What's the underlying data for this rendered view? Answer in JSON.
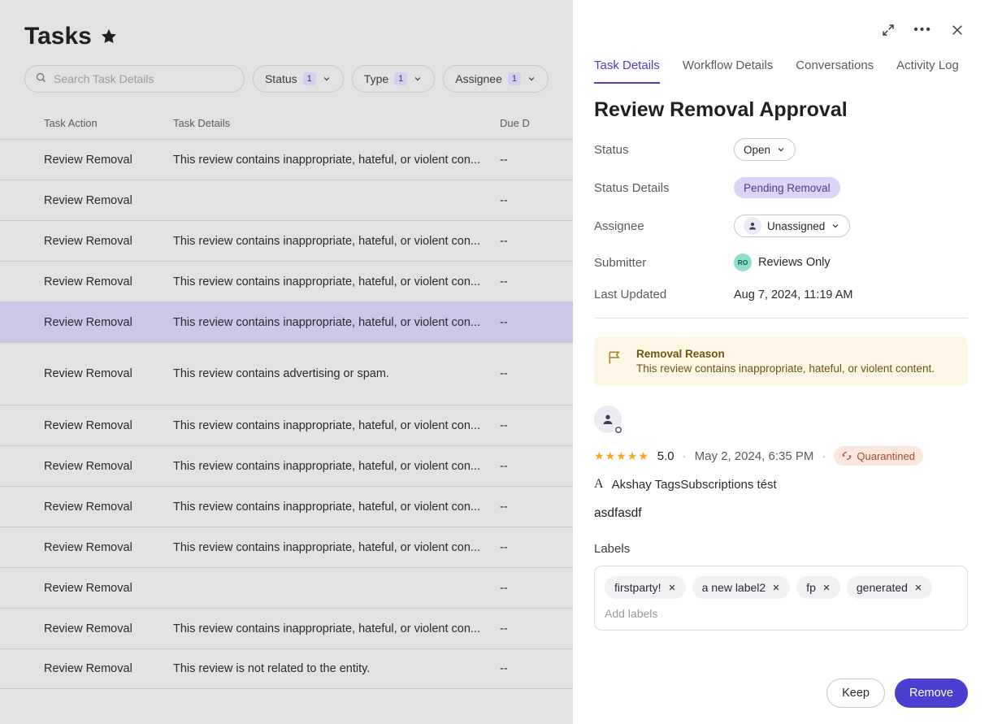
{
  "header": {
    "title": "Tasks"
  },
  "search": {
    "placeholder": "Search Task Details"
  },
  "filters": [
    {
      "label": "Status",
      "count": "1"
    },
    {
      "label": "Type",
      "count": "1"
    },
    {
      "label": "Assignee",
      "count": "1"
    }
  ],
  "columns": {
    "action": "Task Action",
    "details": "Task Details",
    "due": "Due D"
  },
  "rows": [
    {
      "action": "Review Removal",
      "details": "This review contains inappropriate, hateful, or violent con...",
      "due": "--",
      "selected": false,
      "tall": false
    },
    {
      "action": "Review Removal",
      "details": "",
      "due": "--",
      "selected": false,
      "tall": false
    },
    {
      "action": "Review Removal",
      "details": "This review contains inappropriate, hateful, or violent con...",
      "due": "--",
      "selected": false,
      "tall": false
    },
    {
      "action": "Review Removal",
      "details": "This review contains inappropriate, hateful, or violent con...",
      "due": "--",
      "selected": false,
      "tall": false
    },
    {
      "action": "Review Removal",
      "details": "This review contains inappropriate, hateful, or violent con...",
      "due": "--",
      "selected": true,
      "tall": false
    },
    {
      "action": "Review Removal",
      "details": "This review contains advertising or spam.",
      "due": "--",
      "selected": false,
      "tall": true
    },
    {
      "action": "Review Removal",
      "details": "This review contains inappropriate, hateful, or violent con...",
      "due": "--",
      "selected": false,
      "tall": false
    },
    {
      "action": "Review Removal",
      "details": "This review contains inappropriate, hateful, or violent con...",
      "due": "--",
      "selected": false,
      "tall": false
    },
    {
      "action": "Review Removal",
      "details": "This review contains inappropriate, hateful, or violent con...",
      "due": "--",
      "selected": false,
      "tall": false
    },
    {
      "action": "Review Removal",
      "details": "This review contains inappropriate, hateful, or violent con...",
      "due": "--",
      "selected": false,
      "tall": false
    },
    {
      "action": "Review Removal",
      "details": "",
      "due": "--",
      "selected": false,
      "tall": false
    },
    {
      "action": "Review Removal",
      "details": "This review contains inappropriate, hateful, or violent con...",
      "due": "--",
      "selected": false,
      "tall": false
    },
    {
      "action": "Review Removal",
      "details": "This review is not related to the entity.",
      "due": "--",
      "selected": false,
      "tall": false
    }
  ],
  "panel": {
    "tabs": [
      "Task Details",
      "Workflow Details",
      "Conversations",
      "Activity Log"
    ],
    "active_tab": 0,
    "title": "Review Removal Approval",
    "meta": {
      "status_label": "Status",
      "status_value": "Open",
      "status_details_label": "Status Details",
      "status_details_value": "Pending Removal",
      "assignee_label": "Assignee",
      "assignee_value": "Unassigned",
      "submitter_label": "Submitter",
      "submitter_initials": "RO",
      "submitter_value": "Reviews Only",
      "updated_label": "Last Updated",
      "updated_value": "Aug 7, 2024, 11:19 AM"
    },
    "notice": {
      "title": "Removal Reason",
      "text": "This review contains inappropriate, hateful, or violent content."
    },
    "review": {
      "stars": "★★★★★",
      "rating": "5.0",
      "date": "May 2, 2024, 6:35 PM",
      "badge": "Quarantined",
      "merchant_icon": "A",
      "merchant": "Akshay TagsSubscriptions tést",
      "body": "asdfasdf"
    },
    "labels_title": "Labels",
    "labels": [
      "firstparty!",
      "a new label2",
      "fp",
      "generated"
    ],
    "labels_placeholder": "Add labels",
    "footer": {
      "keep": "Keep",
      "remove": "Remove"
    }
  }
}
